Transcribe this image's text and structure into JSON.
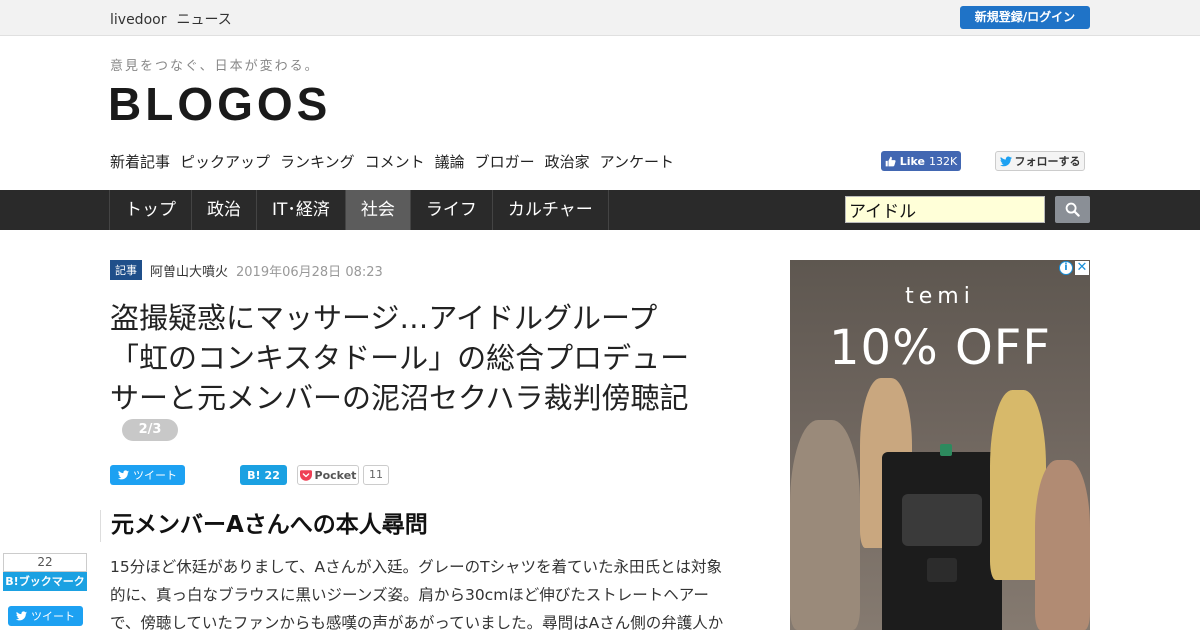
{
  "topbar": {
    "brand_main": "livedoor",
    "brand_sub": "ニュース",
    "login_label": "新規登録/ログイン"
  },
  "header": {
    "tagline": "意見をつなぐ、日本が変わる。",
    "logo": "BLOGOS",
    "subnav": [
      "新着記事",
      "ピックアップ",
      "ランキング",
      "コメント",
      "議論",
      "ブロガー",
      "政治家",
      "アンケート"
    ],
    "fb_like_label": "Like",
    "fb_like_count": "132K",
    "tw_follow_label": "フォローする"
  },
  "mainnav": {
    "tabs": [
      "トップ",
      "政治",
      "IT･経済",
      "社会",
      "ライフ",
      "カルチャー"
    ],
    "active_tab": "社会",
    "search_value": "アイドル"
  },
  "article": {
    "badge": "記事",
    "author": "阿曽山大噴火",
    "date": "2019年06月28日 08:23",
    "title_lines": [
      "盗撮疑惑にマッサージ…アイドルグループ",
      "「虹のコンキスタドール」の総合プロデュー",
      "サーと元メンバーの泥沼セクハラ裁判傍聴記"
    ],
    "page_indicator": "2/3",
    "share": {
      "tweet_label": "ツイート",
      "hatena_count": "22",
      "pocket_label": "Pocket",
      "pocket_count": "11"
    },
    "section_heading": "元メンバーAさんへの本人尋問",
    "body_lines": [
      "15分ほど休廷がありまして、Aさんが入廷。グレーのTシャツを着ていた永田氏とは対象",
      "的に、真っ白なブラウスに黒いジーンズ姿。肩から30cmほど伸びたストレートヘアー",
      "で、傍聴していたファンからも感嘆の声があがっていました。尋問はAさん側の弁護人か"
    ]
  },
  "side_share": {
    "hatena_count": "22",
    "hatena_label": "B!ブックマーク",
    "tweet_label": "ツイート"
  },
  "ad": {
    "brand": "temi",
    "offer": "10% OFF"
  },
  "colors": {
    "nav_bg": "#2a2a2a",
    "login_blue": "#1f73c7",
    "twitter_blue": "#1da1f2",
    "hatena_blue": "#1ba1e2",
    "facebook_blue": "#4267b2"
  }
}
